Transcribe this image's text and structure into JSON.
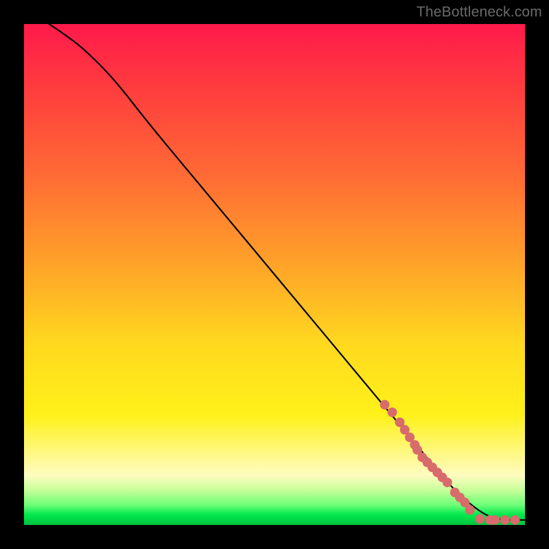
{
  "watermark": "TheBottleneck.com",
  "chart_data": {
    "type": "line",
    "title": "",
    "xlabel": "",
    "ylabel": "",
    "xlim": [
      0,
      100
    ],
    "ylim": [
      0,
      100
    ],
    "curve": {
      "name": "bottleneck-curve",
      "x": [
        5,
        8,
        12,
        18,
        25,
        35,
        45,
        55,
        65,
        75,
        80,
        84,
        88,
        92,
        95,
        100
      ],
      "y": [
        100,
        98,
        95,
        89,
        80,
        68,
        56,
        44,
        32,
        20,
        14,
        9,
        5,
        2,
        1,
        1
      ]
    },
    "points": {
      "name": "data-points",
      "color": "#d86b6b",
      "x": [
        72,
        73.5,
        75,
        76,
        77,
        78,
        78.5,
        79.5,
        80.5,
        81.5,
        82.5,
        83.5,
        84.5,
        86,
        87,
        88,
        89,
        91,
        93,
        94,
        96,
        98
      ],
      "y": [
        24,
        22.5,
        20.5,
        19,
        17.5,
        16,
        15,
        13.5,
        12.5,
        11.5,
        10.5,
        9.5,
        8.5,
        6.5,
        5.5,
        4.5,
        3,
        1.2,
        1.0,
        1.0,
        1.0,
        1.0
      ]
    },
    "gradient_stops": [
      {
        "pct": 0,
        "color": "#ff1a4b"
      },
      {
        "pct": 12,
        "color": "#ff3a3f"
      },
      {
        "pct": 30,
        "color": "#ff6a35"
      },
      {
        "pct": 48,
        "color": "#ffa329"
      },
      {
        "pct": 64,
        "color": "#ffd91f"
      },
      {
        "pct": 78,
        "color": "#fff119"
      },
      {
        "pct": 90,
        "color": "#fffcc0"
      },
      {
        "pct": 93,
        "color": "#c8ff9a"
      },
      {
        "pct": 96,
        "color": "#6dff77"
      },
      {
        "pct": 98,
        "color": "#00e84d"
      },
      {
        "pct": 100,
        "color": "#00c23d"
      }
    ]
  }
}
